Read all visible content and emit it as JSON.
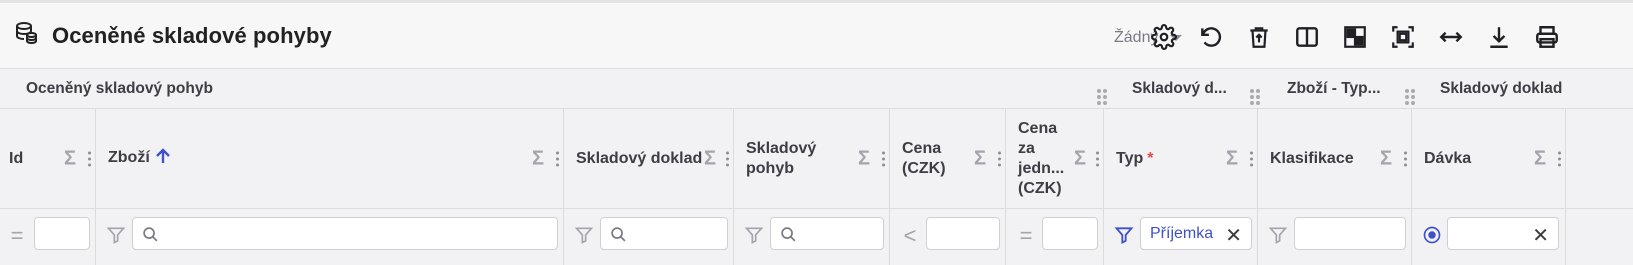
{
  "header": {
    "title": "Oceněné skladové pohyby",
    "view_select_value": "Žádný"
  },
  "toolbar": {
    "icons": [
      "settings-icon",
      "reset-icon",
      "delete-icon",
      "columns-icon",
      "grid-density-icon",
      "fit-screen-icon",
      "resize-horizontal-icon",
      "download-icon",
      "print-icon"
    ]
  },
  "groups": [
    {
      "label": "Oceněný skladový pohyb"
    },
    {
      "label": "Skladový d..."
    },
    {
      "label": "Zboží - Typ..."
    },
    {
      "label": "Skladový doklad"
    }
  ],
  "columns": [
    {
      "label": "Id"
    },
    {
      "label": "Zboží"
    },
    {
      "label": "Skladový doklad"
    },
    {
      "label_l1": "Skladový",
      "label_l2": "pohyb"
    },
    {
      "label_l1": "Cena",
      "label_l2": "(CZK)"
    },
    {
      "label_l1": "Cena",
      "label_l2": "za",
      "label_l3": "jedn...",
      "label_l4": "(CZK)"
    },
    {
      "label": "Typ",
      "required_mark": "*"
    },
    {
      "label": "Klasifikace"
    },
    {
      "label": "Dávka"
    }
  ],
  "filters": {
    "id_operator": "=",
    "cena_operator": "<",
    "cena_jedn_operator": "=",
    "typ_value": "Příjemka",
    "clear_symbol": "✕"
  },
  "colors": {
    "accent": "#3f51c8",
    "required": "#e5484d"
  }
}
